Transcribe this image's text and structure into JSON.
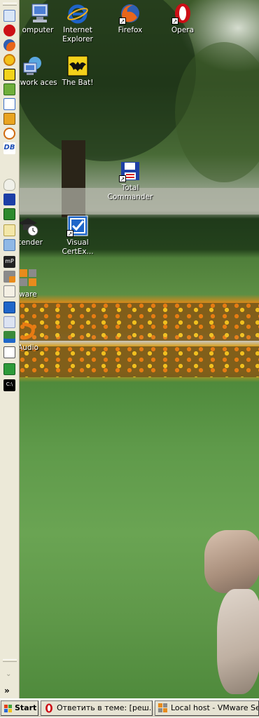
{
  "desktop": {
    "icons": [
      {
        "label": "omputer"
      },
      {
        "label": "Internet Explorer"
      },
      {
        "label": "Firefox"
      },
      {
        "label": "Opera"
      },
      {
        "label": "Network aces"
      },
      {
        "label": "The Bat!"
      },
      {
        "label": "Total Commander"
      },
      {
        "label": "scender"
      },
      {
        "label": "Visual CertEx..."
      },
      {
        "label": "ware"
      },
      {
        "label": "Audio"
      }
    ]
  },
  "quick_launch": {
    "icons": [
      "ie-icon",
      "opera-icon",
      "firefox-icon",
      "clock-icon",
      "thebat-icon",
      "network-icon",
      "mail-icon",
      "arc-icon",
      "db-icon",
      "bulb-icon",
      "save-icon",
      "install-icon",
      "compass-icon",
      "devices-icon",
      "mp-icon",
      "grid-icon",
      "cap-icon",
      "check-icon",
      "tools-icon",
      "chart-icon",
      "printer-icon",
      "p-icon",
      "cmd-icon"
    ],
    "chevron": "»"
  },
  "taskbar": {
    "start_label": "Start",
    "tasks": [
      {
        "label": "Ответить в теме: [реш..."
      },
      {
        "label": "Local host - VMware Ser..."
      }
    ]
  },
  "colors": {
    "taskbar_bg": "#dedbcb",
    "quicklaunch_bg": "#ece9d8",
    "opera_red": "#cc0f16",
    "ie_blue": "#1e63c8"
  }
}
